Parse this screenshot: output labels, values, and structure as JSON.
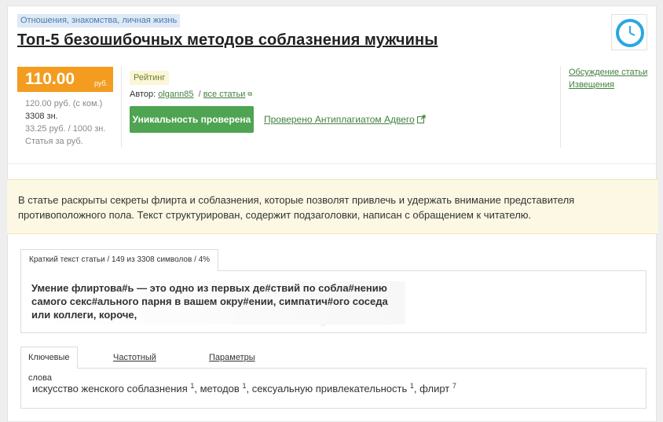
{
  "article": {
    "category": "Отношения, знакомства, личная жизнь",
    "title": "Топ-5 безошибочных методов соблазнения мужчины"
  },
  "price": {
    "amount": "110.00",
    "currency": "руб.",
    "per_thousand_chars": "120.00 руб. (с ком.)",
    "chars": "3308 зн.",
    "per_1000": "33.25 руб.  / 1000 зн.",
    "note": "Статья за руб."
  },
  "meta": {
    "rating_label": "Рейтинг",
    "author_label": "Автор:",
    "author_name": "olgann85",
    "separator": "/",
    "all_articles": "все статьи",
    "uniqueness_button": "Уникальность проверена",
    "verified_link": "Проверено Антиплагиатом Адвего"
  },
  "links": {
    "discussion": "Обсуждение статьи",
    "notifications": "Извещения"
  },
  "description": "В статье раскрыты секреты флирта и соблазнения, которые позволят привлечь и удержать внимание представителя противоположного пола. Текст структурирован, содержит подзаголовки, написан с обращением к читателю.",
  "excerpt_tab": {
    "label": "Краткий текст статьи / 149 из 3308 символов / 4%",
    "text": "Умение флиртова#ь — это одно из первых де#ствий по собла#нению самого секс#ального парня в вашем окру#ении, симпатич#ого соседа или коллеги, короче,"
  },
  "keyword_tabs": {
    "tabs": [
      "Ключевые слова",
      "Частотный словарь",
      "Параметры"
    ],
    "keywords": [
      {
        "word": "искусство женского соблазнения",
        "count": "1"
      },
      {
        "word": "методов",
        "count": "1"
      },
      {
        "word": "сексуальную привлекательность",
        "count": "1"
      },
      {
        "word": "флирт",
        "count": "7"
      }
    ]
  },
  "colors": {
    "accent_orange": "#f39c1f",
    "accent_green": "#4ea451",
    "link_green": "#43803f",
    "notice_bg": "#fcf8e3"
  },
  "icons": {
    "clock": "clock-icon",
    "external": "external-link-icon"
  }
}
